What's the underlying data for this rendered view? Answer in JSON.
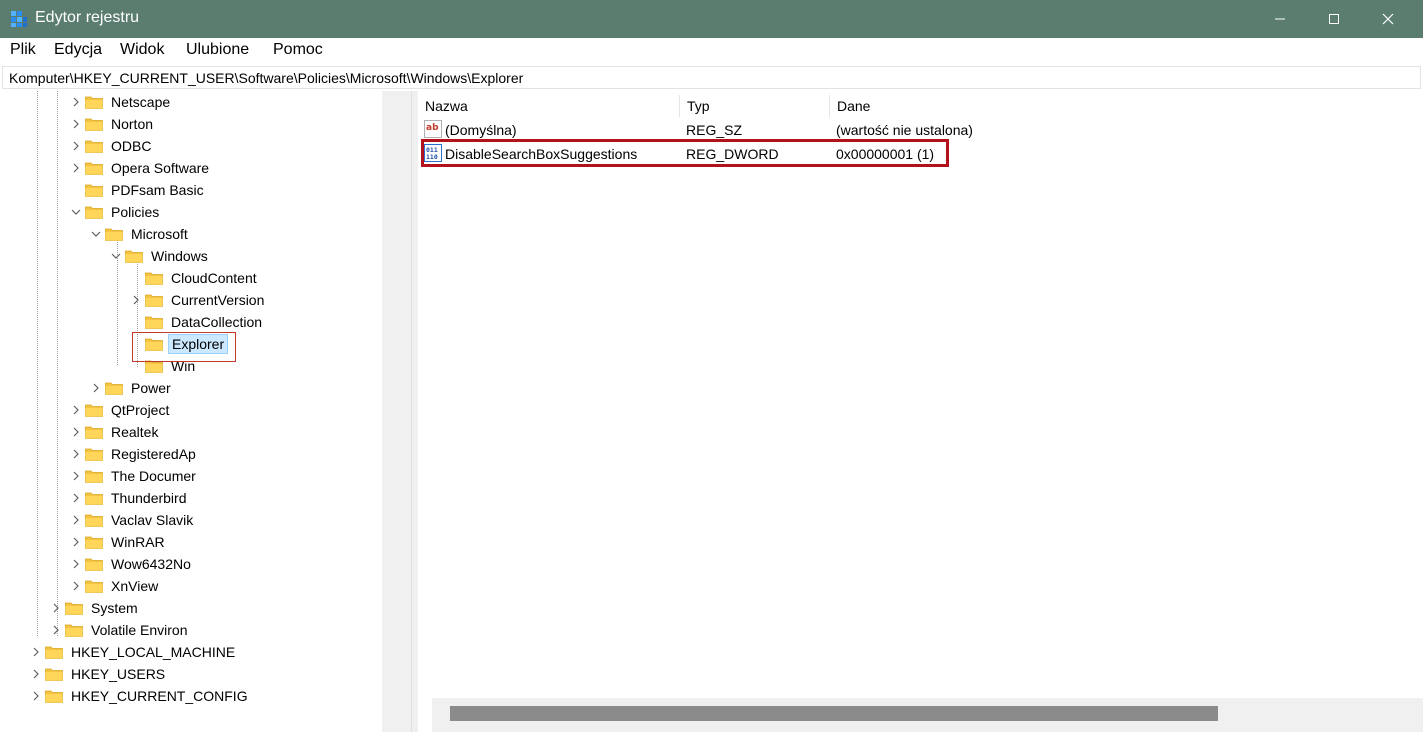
{
  "window": {
    "title": "Edytor rejestru",
    "accent_color": "#5a7d70"
  },
  "menu": [
    "Plik",
    "Edycja",
    "Widok",
    "Ulubione",
    "Pomoc"
  ],
  "address": "Komputer\\HKEY_CURRENT_USER\\Software\\Policies\\Microsoft\\Windows\\Explorer",
  "tree": [
    {
      "label": "Netscape",
      "expander": "collapsed",
      "level": 2
    },
    {
      "label": "Norton",
      "expander": "collapsed",
      "level": 2
    },
    {
      "label": "ODBC",
      "expander": "collapsed",
      "level": 2
    },
    {
      "label": "Opera Software",
      "expander": "collapsed",
      "level": 2
    },
    {
      "label": "PDFsam Basic",
      "expander": "none",
      "level": 2
    },
    {
      "label": "Policies",
      "expander": "expanded",
      "level": 2
    },
    {
      "label": "Microsoft",
      "expander": "expanded",
      "level": 3
    },
    {
      "label": "Windows",
      "expander": "expanded",
      "level": 4
    },
    {
      "label": "CloudContent",
      "expander": "none",
      "level": 5
    },
    {
      "label": "CurrentVersion",
      "expander": "collapsed",
      "level": 5
    },
    {
      "label": "DataCollection",
      "expander": "none",
      "level": 5
    },
    {
      "label": "Explorer",
      "expander": "none",
      "level": 5,
      "selected": true
    },
    {
      "label": "Win",
      "expander": "none",
      "level": 5
    },
    {
      "label": "Power",
      "expander": "collapsed",
      "level": 3
    },
    {
      "label": "QtProject",
      "expander": "collapsed",
      "level": 2
    },
    {
      "label": "Realtek",
      "expander": "collapsed",
      "level": 2
    },
    {
      "label": "RegisteredAp",
      "expander": "collapsed",
      "level": 2
    },
    {
      "label": "The Documer",
      "expander": "collapsed",
      "level": 2
    },
    {
      "label": "Thunderbird",
      "expander": "collapsed",
      "level": 2
    },
    {
      "label": "Vaclav Slavik",
      "expander": "collapsed",
      "level": 2
    },
    {
      "label": "WinRAR",
      "expander": "collapsed",
      "level": 2
    },
    {
      "label": "Wow6432No",
      "expander": "collapsed",
      "level": 2
    },
    {
      "label": "XnView",
      "expander": "collapsed",
      "level": 2
    },
    {
      "label": "System",
      "expander": "collapsed",
      "level": 1
    },
    {
      "label": "Volatile Environ",
      "expander": "collapsed",
      "level": 1
    },
    {
      "label": "HKEY_LOCAL_MACHINE",
      "expander": "collapsed",
      "level": 0
    },
    {
      "label": "HKEY_USERS",
      "expander": "collapsed",
      "level": 0
    },
    {
      "label": "HKEY_CURRENT_CONFIG",
      "expander": "collapsed",
      "level": 0
    }
  ],
  "list": {
    "columns": [
      "Nazwa",
      "Typ",
      "Dane"
    ],
    "rows": [
      {
        "icon": "string-value-icon",
        "name": "(Domyślna)",
        "type": "REG_SZ",
        "data": "(wartość nie ustalona)"
      },
      {
        "icon": "binary-value-icon",
        "name": "DisableSearchBoxSuggestions",
        "type": "REG_DWORD",
        "data": "0x00000001 (1)"
      }
    ]
  },
  "highlight_color": "#b3121c"
}
